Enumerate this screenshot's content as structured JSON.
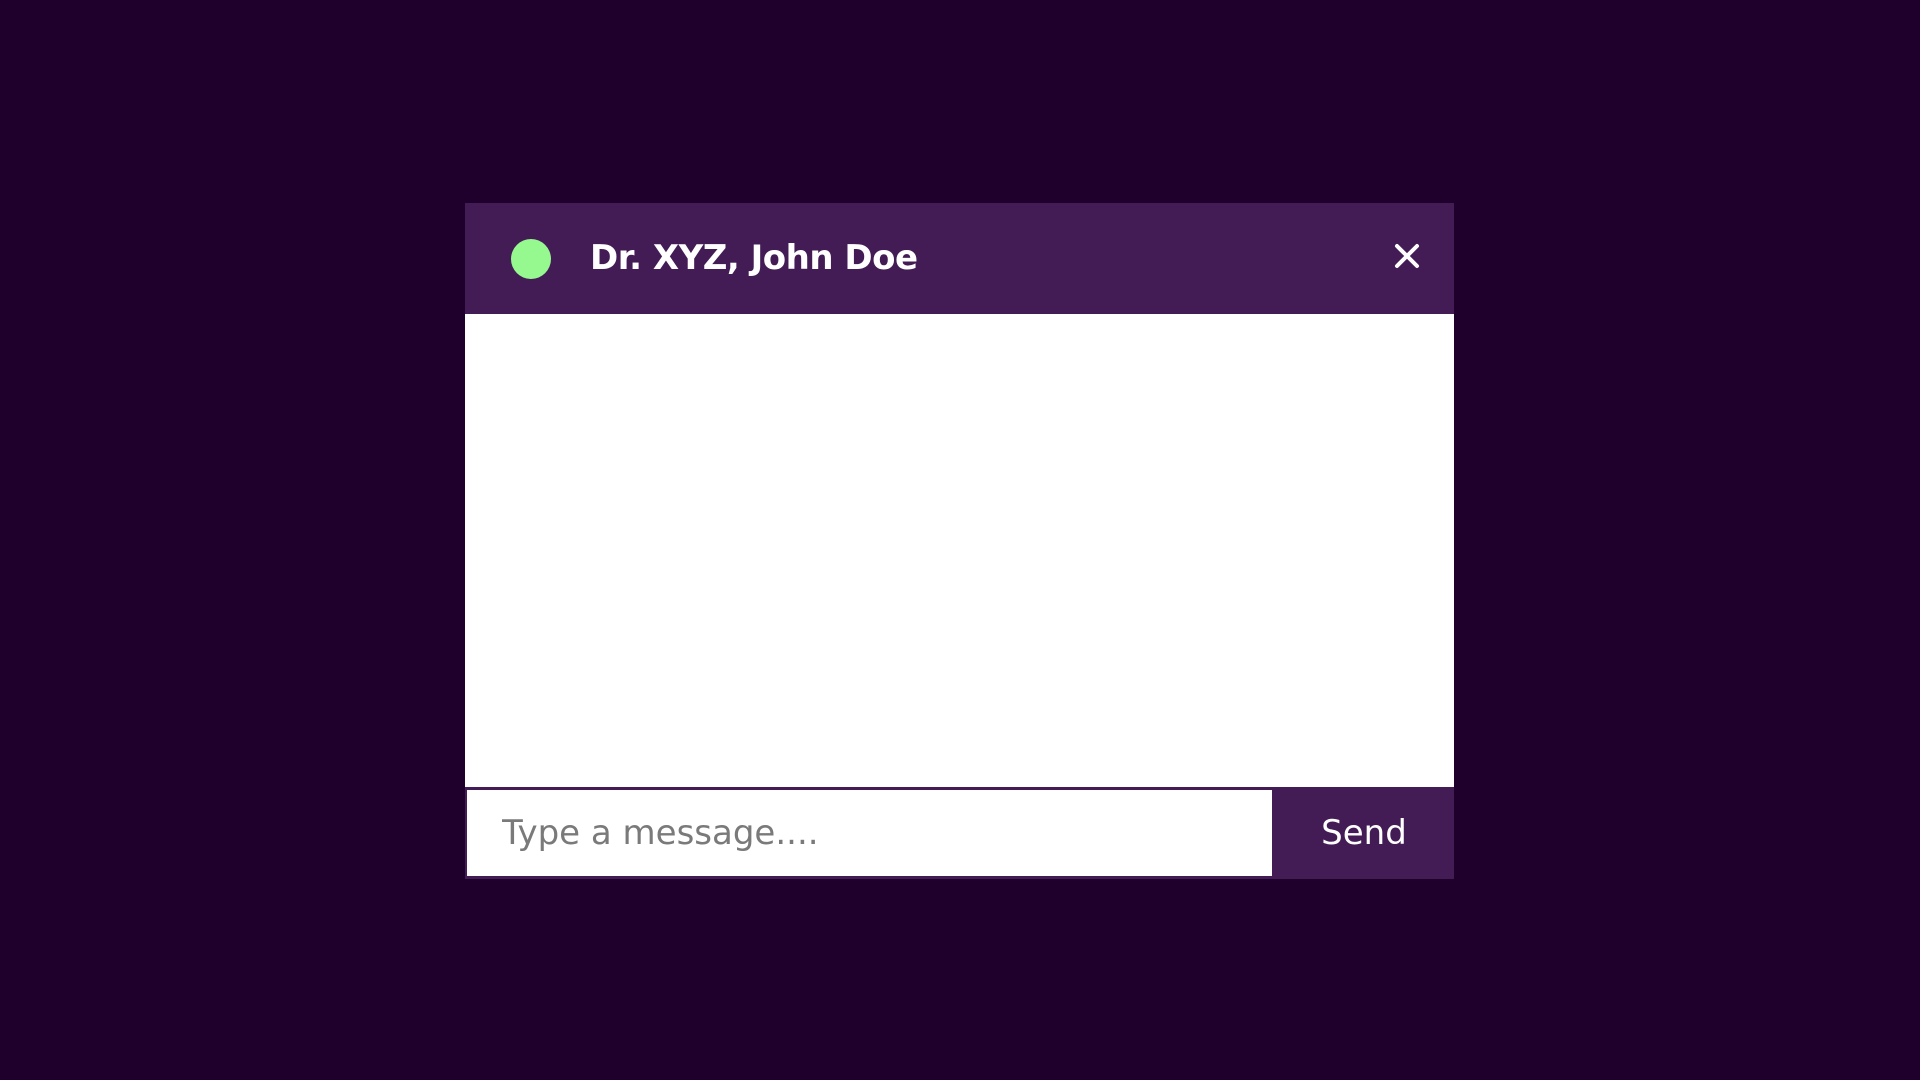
{
  "chat": {
    "title": "Dr. XYZ, John Doe",
    "status": "online",
    "close_icon": "close-icon"
  },
  "composer": {
    "input_value": "",
    "input_placeholder": "Type a message....",
    "send_label": "Send"
  },
  "colors": {
    "background": "#1f002d",
    "header": "#431c55",
    "status_online": "#96f98f",
    "message_area": "#ffffff",
    "text_light": "#ffffff",
    "placeholder": "#7a7a7a"
  }
}
